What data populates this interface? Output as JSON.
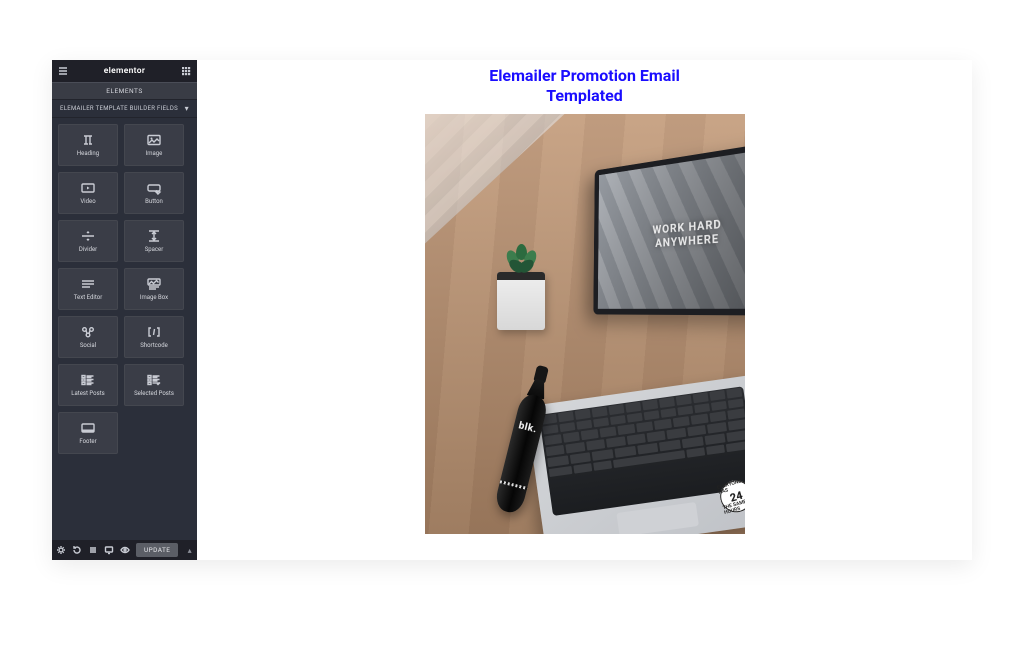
{
  "brand": "elementor",
  "tabs": {
    "elements": "ELEMENTS"
  },
  "section": {
    "title": "ELEMAILER TEMPLATE BUILDER FIELDS"
  },
  "widgets": [
    {
      "id": "heading",
      "label": "Heading"
    },
    {
      "id": "image",
      "label": "Image"
    },
    {
      "id": "video",
      "label": "Video"
    },
    {
      "id": "button",
      "label": "Button"
    },
    {
      "id": "divider",
      "label": "Divider"
    },
    {
      "id": "spacer",
      "label": "Spacer"
    },
    {
      "id": "text-editor",
      "label": "Text Editor"
    },
    {
      "id": "image-box",
      "label": "Image Box"
    },
    {
      "id": "social",
      "label": "Social"
    },
    {
      "id": "shortcode",
      "label": "Shortcode"
    },
    {
      "id": "latest-posts",
      "label": "Latest Posts"
    },
    {
      "id": "selected-posts",
      "label": "Selected Posts"
    },
    {
      "id": "footer",
      "label": "Footer"
    }
  ],
  "footer": {
    "update": "UPDATE"
  },
  "email": {
    "title_line1": "Elemailer Promotion Email",
    "title_line2": "Templated",
    "screen_line1": "WORK HARD",
    "screen_line2": "ANYWHERE",
    "bottle_label": "blk.",
    "sticker_top": "EVERYONE HAS",
    "sticker_num": "24",
    "sticker_bot": "THE SAME HOURS"
  }
}
